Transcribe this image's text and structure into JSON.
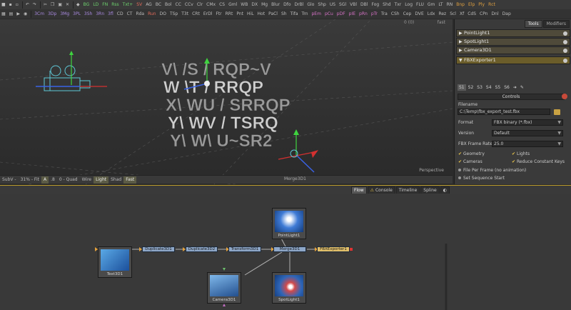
{
  "toolbar": {
    "row1": [
      {
        "t": "BG",
        "c": "c-green"
      },
      {
        "t": "LD",
        "c": "c-green"
      },
      {
        "t": "FN",
        "c": "c-green"
      },
      {
        "t": "Rss",
        "c": "c-green"
      },
      {
        "t": "Txt+",
        "c": "c-green"
      },
      {
        "t": "SV",
        "c": "c-red"
      },
      {
        "t": "AG",
        "c": ""
      },
      {
        "t": "BC",
        "c": ""
      },
      {
        "t": "Bol",
        "c": ""
      },
      {
        "t": "CC",
        "c": ""
      },
      {
        "t": "CCv",
        "c": ""
      },
      {
        "t": "Clr",
        "c": ""
      },
      {
        "t": "CMx",
        "c": ""
      },
      {
        "t": "CS",
        "c": ""
      },
      {
        "t": "Gml",
        "c": ""
      },
      {
        "t": "WB",
        "c": ""
      },
      {
        "t": "DX",
        "c": ""
      },
      {
        "t": "Mg",
        "c": ""
      },
      {
        "t": "Blur",
        "c": ""
      },
      {
        "t": "Dfo",
        "c": ""
      },
      {
        "t": "DrBl",
        "c": ""
      },
      {
        "t": "Glo",
        "c": ""
      },
      {
        "t": "Shp",
        "c": ""
      },
      {
        "t": "US",
        "c": ""
      },
      {
        "t": "SGl",
        "c": ""
      },
      {
        "t": "VBl",
        "c": ""
      },
      {
        "t": "DBl",
        "c": ""
      },
      {
        "t": "Fog",
        "c": ""
      },
      {
        "t": "Shd",
        "c": ""
      },
      {
        "t": "Txr",
        "c": ""
      },
      {
        "t": "Log",
        "c": ""
      },
      {
        "t": "FLU",
        "c": ""
      },
      {
        "t": "Gm",
        "c": ""
      },
      {
        "t": "LT",
        "c": ""
      },
      {
        "t": "RN",
        "c": ""
      },
      {
        "t": "Bnp",
        "c": "c-orange"
      },
      {
        "t": "Elp",
        "c": "c-orange"
      },
      {
        "t": "Ply",
        "c": "c-orange"
      },
      {
        "t": "Rct",
        "c": "c-orange"
      }
    ],
    "row2": [
      {
        "t": "3Cm",
        "c": "c-purple"
      },
      {
        "t": "3Dp",
        "c": "c-purple"
      },
      {
        "t": "3Mg",
        "c": "c-purple"
      },
      {
        "t": "3PL",
        "c": "c-purple"
      },
      {
        "t": "3Sh",
        "c": "c-purple"
      },
      {
        "t": "3Rn",
        "c": "c-purple"
      },
      {
        "t": "3fl",
        "c": "c-purple"
      },
      {
        "t": "CD",
        "c": ""
      },
      {
        "t": "CT",
        "c": ""
      },
      {
        "t": "Rda",
        "c": ""
      },
      {
        "t": "Run",
        "c": "c-red"
      },
      {
        "t": "DO",
        "c": ""
      },
      {
        "t": "TSp",
        "c": ""
      },
      {
        "t": "T3t",
        "c": ""
      },
      {
        "t": "CRt",
        "c": ""
      },
      {
        "t": "ErDl",
        "c": ""
      },
      {
        "t": "Ftr",
        "c": ""
      },
      {
        "t": "RRt",
        "c": ""
      },
      {
        "t": "Pnt",
        "c": ""
      },
      {
        "t": "HiL",
        "c": ""
      },
      {
        "t": "Hot",
        "c": ""
      },
      {
        "t": "PaCl",
        "c": ""
      },
      {
        "t": "Sh",
        "c": ""
      },
      {
        "t": "Tifa",
        "c": ""
      },
      {
        "t": "Trn",
        "c": ""
      },
      {
        "t": "pEm",
        "c": "c-pink"
      },
      {
        "t": "pCu",
        "c": "c-pink"
      },
      {
        "t": "pDF",
        "c": "c-pink"
      },
      {
        "t": "pIE",
        "c": "c-pink"
      },
      {
        "t": "pRn",
        "c": "c-pink"
      },
      {
        "t": "pTr",
        "c": "c-pink"
      },
      {
        "t": "Tra",
        "c": ""
      },
      {
        "t": "CSh",
        "c": ""
      },
      {
        "t": "Cep",
        "c": ""
      },
      {
        "t": "DVE",
        "c": ""
      },
      {
        "t": "Ldx",
        "c": ""
      },
      {
        "t": "Rez",
        "c": ""
      },
      {
        "t": "Scl",
        "c": ""
      },
      {
        "t": "Xf",
        "c": ""
      },
      {
        "t": "CdS",
        "c": ""
      },
      {
        "t": "CPn",
        "c": ""
      },
      {
        "t": "Dnl",
        "c": ""
      },
      {
        "t": "Dap",
        "c": ""
      }
    ]
  },
  "viewer": {
    "time": "0 (0)",
    "right_flag": "fast",
    "view_label": "Perspective",
    "text_lines": [
      "V\\ /S / RQP~V",
      "W \\T / RRQP",
      "X\\ WU / SRRQP",
      "Y\\ WV / TSRQ",
      "Y\\ W\\ U~SR2"
    ]
  },
  "viewer_bar": {
    "items": [
      {
        "t": "SubV -",
        "on": false
      },
      {
        "t": "31% - Fit",
        "on": false
      },
      {
        "t": "A",
        "on": true
      },
      {
        "t": ".8",
        "on": false
      },
      {
        "t": "0 - Quad",
        "on": false
      },
      {
        "t": "Wire",
        "on": false
      },
      {
        "t": "Light",
        "on": true
      },
      {
        "t": "Shad",
        "on": false
      },
      {
        "t": "Fast",
        "on": true
      }
    ],
    "node_name": "Merge3D1"
  },
  "panel": {
    "tabs": [
      "Tools",
      "Modifiers"
    ],
    "tools": [
      "PointLight1",
      "SpotLight1",
      "Camera3D1",
      "FBXExporter1"
    ],
    "ctl_tabs": [
      "S1",
      "S2",
      "S3",
      "S4",
      "S5",
      "S6"
    ],
    "controls": "Controls",
    "filename_label": "Filename",
    "filename": "C:\\Temp\\fbx_export_test.fbx",
    "format_label": "Format",
    "format": "FBX binary (*.fbx)",
    "version_label": "Version",
    "version": "Default",
    "framerate_label": "FBX Frame Rate",
    "framerate": "25.0",
    "checks": [
      "Geometry",
      "Lights",
      "Cameras",
      "Reduce Constant Keys"
    ],
    "radio1": "File Per Frame (no animation)",
    "radio2": "Set Sequence Start"
  },
  "flow": {
    "tabs": [
      "Flow",
      "Console",
      "Timeline",
      "Spline"
    ],
    "nodes": [
      "Duplicate3D1",
      "Duplicate3D2",
      "Transform3D1",
      "Merge3D1",
      "FBXExporter1"
    ],
    "thumbs": [
      "Text3D1",
      "PointLight1",
      "Camera3D1",
      "SpotLight1"
    ]
  }
}
